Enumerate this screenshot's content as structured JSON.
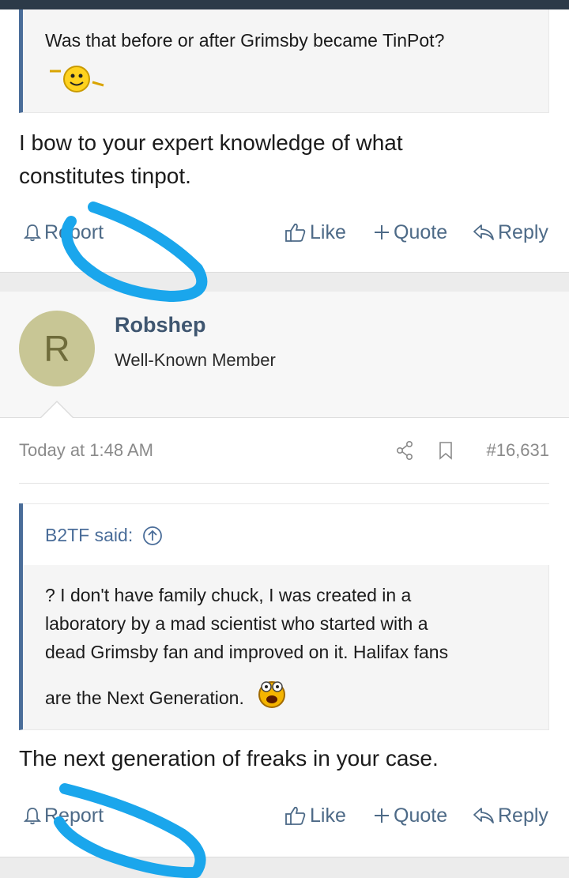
{
  "post1": {
    "quote_text": "Was that before or after Grimsby became TinPot?",
    "body_line1": "I bow to your expert knowledge of what",
    "body_line2": "constitutes tinpot.",
    "actions": {
      "report": "Report",
      "like": "Like",
      "quote": "Quote",
      "reply": "Reply"
    }
  },
  "post2": {
    "avatar_letter": "R",
    "username": "Robshep",
    "user_title": "Well-Known Member",
    "date": "Today at 1:48 AM",
    "post_number": "#16,631",
    "quote_author": "B2TF said:",
    "quote_line1": "? I don't have family chuck, I was created in a",
    "quote_line2": "laboratory by a mad scientist who started with a",
    "quote_line3": "dead Grimsby fan and improved on it. Halifax fans",
    "quote_line4": "are the Next Generation.",
    "body": "The next generation of freaks in your case.",
    "actions": {
      "report": "Report",
      "like": "Like",
      "quote": "Quote",
      "reply": "Reply"
    }
  },
  "colors": {
    "link": "#4d6a87",
    "quote_border": "#4a6d99",
    "avatar_bg": "#c8c695",
    "highlight_scribble": "#1aa6ec"
  },
  "icons": [
    "bell-icon",
    "thumbs-up-icon",
    "plus-icon",
    "reply-arrow-icon",
    "share-icon",
    "bookmark-icon",
    "arrow-up-circle-icon",
    "waving-smiley-icon",
    "shocked-smiley-icon"
  ]
}
